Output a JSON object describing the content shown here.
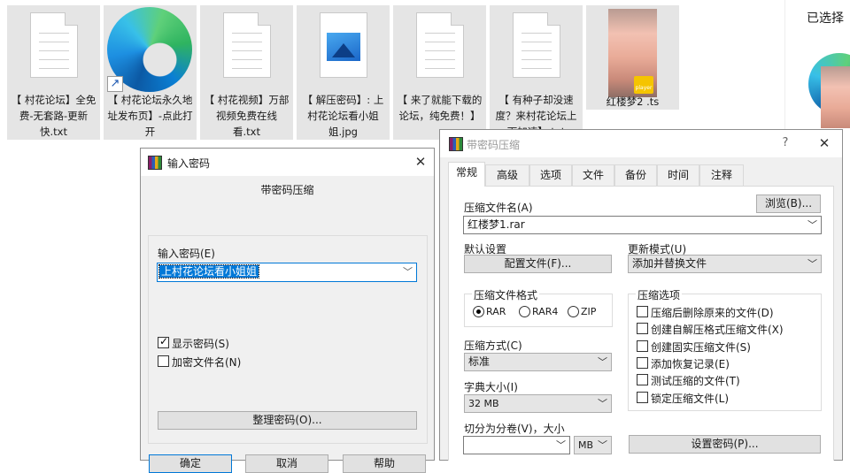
{
  "desktop": {
    "files": [
      {
        "name": "【 村花论坛】全免费-无套路-更新快.txt",
        "icon": "text-file-icon"
      },
      {
        "name": "【 村花论坛永久地址发布页】-点此打开",
        "icon": "edge-shortcut-icon"
      },
      {
        "name": "【 村花视频】万部视频免费在线看.txt",
        "icon": "text-file-icon"
      },
      {
        "name": "【 解压密码】: 上村花论坛看小姐姐.jpg",
        "icon": "image-file-icon"
      },
      {
        "name": "【 来了就能下载的论坛，纯免费！】",
        "icon": "text-file-icon"
      },
      {
        "name": "【 有种子却没速度？来村花论坛上下加速】.txt",
        "icon": "text-file-icon"
      },
      {
        "name": "红楼梦2 .ts",
        "icon": "video-thumbnail-icon"
      }
    ],
    "right_panel_title": "已选择",
    "player_badge": "player"
  },
  "password_dialog": {
    "title": "输入密码",
    "subtitle": "带密码压缩",
    "password_label": "输入密码(E)",
    "password_value": "上村花论坛看小姐姐",
    "show_password_label": "显示密码(S)",
    "show_password_checked": true,
    "encrypt_names_label": "加密文件名(N)",
    "encrypt_names_checked": false,
    "organize_button": "整理密码(O)...",
    "ok_button": "确定",
    "cancel_button": "取消",
    "help_button": "帮助"
  },
  "compress_dialog": {
    "title": "带密码压缩",
    "help_glyph": "?",
    "tabs": [
      "常规",
      "高级",
      "选项",
      "文件",
      "备份",
      "时间",
      "注释"
    ],
    "active_tab": "常规",
    "archive_name_label": "压缩文件名(A)",
    "browse_button": "浏览(B)...",
    "archive_name_value": "红楼梦1.rar",
    "default_settings_label": "默认设置",
    "profiles_button": "配置文件(F)...",
    "update_mode_label": "更新模式(U)",
    "update_mode_value": "添加并替换文件",
    "format_group_label": "压缩文件格式",
    "formats": [
      {
        "label": "RAR",
        "selected": true
      },
      {
        "label": "RAR4",
        "selected": false
      },
      {
        "label": "ZIP",
        "selected": false
      }
    ],
    "method_label": "压缩方式(C)",
    "method_value": "标准",
    "dict_label": "字典大小(I)",
    "dict_value": "32 MB",
    "split_label": "切分为分卷(V)，大小",
    "split_value": "",
    "split_unit": "MB",
    "options_group_label": "压缩选项",
    "options": [
      {
        "label": "压缩后删除原来的文件(D)",
        "checked": false
      },
      {
        "label": "创建自解压格式压缩文件(X)",
        "checked": false
      },
      {
        "label": "创建固实压缩文件(S)",
        "checked": false
      },
      {
        "label": "添加恢复记录(E)",
        "checked": false
      },
      {
        "label": "测试压缩的文件(T)",
        "checked": false
      },
      {
        "label": "锁定压缩文件(L)",
        "checked": false
      }
    ],
    "set_password_button": "设置密码(P)..."
  }
}
